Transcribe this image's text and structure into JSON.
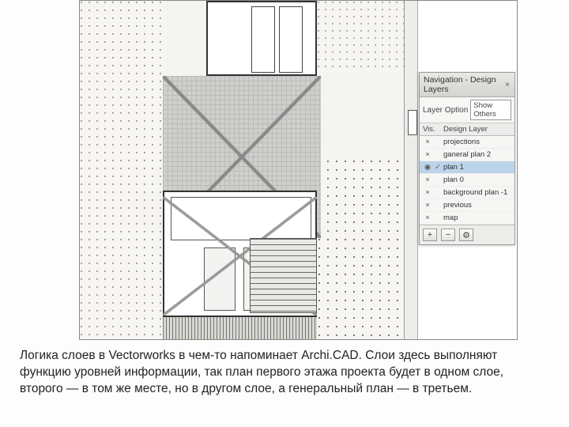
{
  "palette": {
    "title": "Navigation - Design Layers",
    "options_label": "Layer Option",
    "options_value": "Show Others",
    "col_vis": "Vis.",
    "col_layer": "Design Layer",
    "layers": [
      {
        "name": "projections",
        "selected": false
      },
      {
        "name": "ganeral plan 2",
        "selected": false
      },
      {
        "name": "plan 1",
        "selected": true
      },
      {
        "name": "plan 0",
        "selected": false
      },
      {
        "name": "background plan -1",
        "selected": false
      },
      {
        "name": "previous",
        "selected": false
      },
      {
        "name": "map",
        "selected": false
      }
    ]
  },
  "icons": {
    "close": "×",
    "vis_on": "◉",
    "vis_off": "×",
    "check": "✓",
    "plus": "+",
    "minus": "−",
    "gear": "⚙"
  },
  "caption": "Логика слоев в Vectorworks в чем-то напоминает Archi.CAD. Слои здесь выполняют функцию уровней информации, так план первого этажа проекта будет в одном слое, второго — в том же месте, но в другом слое, а генеральный план — в третьем."
}
